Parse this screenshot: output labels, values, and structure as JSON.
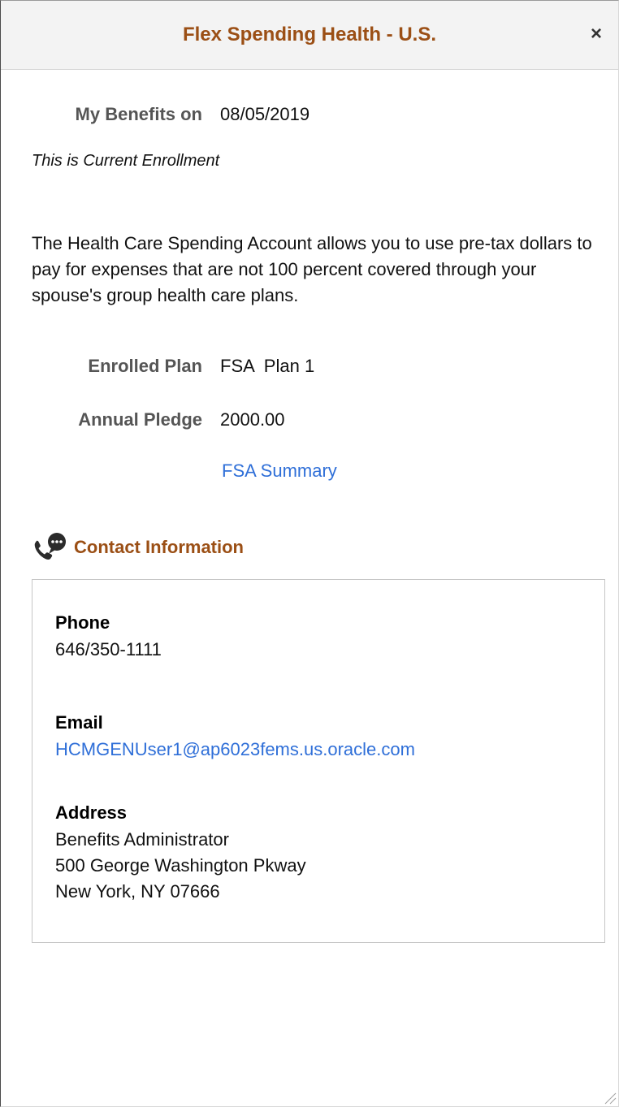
{
  "dialog": {
    "title": "Flex Spending Health - U.S.",
    "close_symbol": "×",
    "corner_mark": "⇕"
  },
  "benefits_date": {
    "label": "My Benefits on",
    "value": "08/05/2019"
  },
  "enrollment_status": "This is Current Enrollment",
  "description": "The Health Care Spending Account allows you to use pre-tax dollars to pay for expenses that are not 100 percent covered through your spouse's group health care plans.",
  "enrolled_plan": {
    "label": "Enrolled Plan",
    "value": "FSA  Plan 1"
  },
  "annual_pledge": {
    "label": "Annual Pledge",
    "value": "2000.00"
  },
  "fsa_summary_link": "FSA Summary",
  "contact": {
    "heading": "Contact Information",
    "icon": "phone-chat-icon",
    "phone_label": "Phone",
    "phone_value": "646/350-1111",
    "email_label": "Email",
    "email_value": "HCMGENUser1@ap6023fems.us.oracle.com",
    "address_label": "Address",
    "address_lines": [
      "Benefits Administrator",
      "500 George Washington Pkway",
      "New York, NY 07666"
    ]
  },
  "colors": {
    "title_brown": "#9b4f15",
    "link_blue": "#2f6fd8",
    "label_gray": "#555555",
    "header_bg": "#f3f3f3"
  }
}
